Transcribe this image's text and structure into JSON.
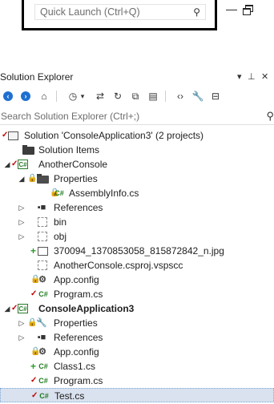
{
  "quick_launch": {
    "placeholder": "Quick Launch (Ctrl+Q)"
  },
  "panel": {
    "title": "Solution Explorer"
  },
  "search": {
    "placeholder": "Search Solution Explorer (Ctrl+;)"
  },
  "tree": [
    {
      "label": "Solution 'ConsoleApplication3' (2 projects)",
      "icon": "solution-icon"
    },
    {
      "label": "Solution Items",
      "icon": "folder-icon"
    },
    {
      "label": "AnotherConsole",
      "icon": "csharp-project-icon"
    },
    {
      "label": "Properties",
      "icon": "properties-folder-icon"
    },
    {
      "label": "AssemblyInfo.cs",
      "icon": "csharp-file-icon",
      "badge": "C#"
    },
    {
      "label": "References",
      "icon": "references-icon"
    },
    {
      "label": "bin",
      "icon": "excluded-folder-icon"
    },
    {
      "label": "obj",
      "icon": "excluded-folder-icon"
    },
    {
      "label": "370094_1370853058_815872842_n.jpg",
      "icon": "image-file-icon"
    },
    {
      "label": "AnotherConsole.csproj.vspscc",
      "icon": "excluded-file-icon"
    },
    {
      "label": "App.config",
      "icon": "config-file-icon"
    },
    {
      "label": "Program.cs",
      "icon": "csharp-file-icon",
      "badge": "C#"
    },
    {
      "label": "ConsoleApplication3",
      "icon": "csharp-project-icon"
    },
    {
      "label": "Properties",
      "icon": "properties-folder-icon"
    },
    {
      "label": "References",
      "icon": "references-icon"
    },
    {
      "label": "App.config",
      "icon": "config-file-icon"
    },
    {
      "label": "Class1.cs",
      "icon": "csharp-file-icon",
      "badge": "C#"
    },
    {
      "label": "Program.cs",
      "icon": "csharp-file-icon",
      "badge": "C#"
    },
    {
      "label": "Test.cs",
      "icon": "csharp-file-icon",
      "badge": "C#"
    }
  ],
  "colors": {
    "selection": "#cce4f7",
    "checkout_mark": "#c00000",
    "added_mark": "#2a9d2a",
    "lock_mark": "#2b6cb0"
  }
}
